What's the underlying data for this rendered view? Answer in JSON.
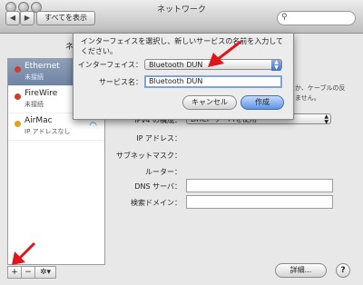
{
  "window": {
    "title": "ネットワーク"
  },
  "toolbar": {
    "back": "◀",
    "forward": "▶",
    "show_all": "すべてを表示",
    "search_icon": "search-icon"
  },
  "location": {
    "label_fragment": "ネ"
  },
  "services": [
    {
      "name": "Ethernet",
      "status": "未接続",
      "dot_color": "#d23a2c",
      "selected": true
    },
    {
      "name": "FireWire",
      "status": "未接続",
      "dot_color": "#d23a2c",
      "selected": false
    },
    {
      "name": "AirMac",
      "status": "IP アドレスなし",
      "dot_color": "#e4a21a",
      "selected": false
    }
  ],
  "sidebar_tools": {
    "add": "+",
    "remove": "−",
    "gear": "✲▾"
  },
  "sheet": {
    "message": "インターフェイスを選択し、新しいサービスの名前を入力してください。",
    "interface_label": "インターフェイス：",
    "interface_value": "Bluetooth DUN",
    "service_label": "サービス名：",
    "service_value": "Bluetooth DUN",
    "cancel": "キャンセル",
    "create": "作成"
  },
  "background_text": {
    "line1": "か、ケーブルの反",
    "line2": "ません。"
  },
  "config": {
    "ipv4_label": "IPv4 の構成：",
    "ipv4_value": "DHCP サーバを使用",
    "ip_label": "IP アドレス：",
    "subnet_label": "サブネットマスク：",
    "router_label": "ルーター：",
    "dns_label": "DNS サーバ：",
    "search_domain_label": "検索ドメイン："
  },
  "advanced": "詳細...",
  "help": "?",
  "colors": {
    "annotation_arrow": "#e0141a",
    "selection": "#7488a8",
    "focus_ring": "#7fa4dd"
  }
}
